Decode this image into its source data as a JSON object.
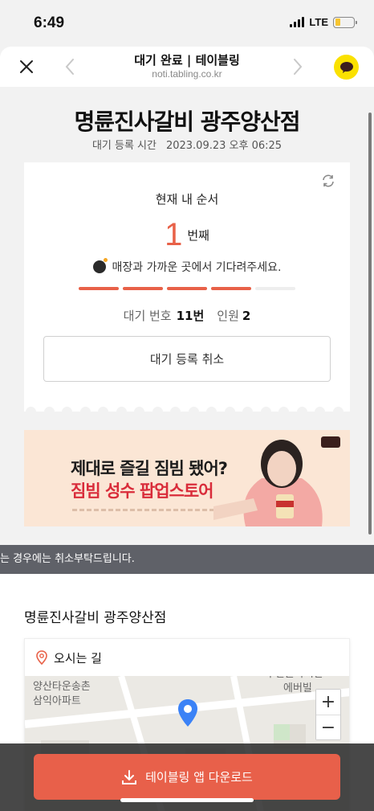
{
  "status_bar": {
    "time": "6:49",
    "network": "LTE",
    "battery_level": 0.3,
    "battery_color": "#f7c531"
  },
  "nav": {
    "title": "대기 완료 | 테이블링",
    "url": "noti.tabling.co.kr"
  },
  "store": {
    "name": "명륜진사갈비 광주양산점",
    "reg_label": "대기 등록 시간",
    "reg_time": "2023.09.23 오후 06:25"
  },
  "queue": {
    "order_label": "현재 내 순서",
    "order_number": "1",
    "order_unit": "번째",
    "message": "매장과 가까운 곳에서 기다려주세요.",
    "progress_steps_total": 5,
    "progress_steps_done": 4,
    "waiting_number_label": "대기 번호",
    "waiting_number": "11번",
    "people_label": "인원",
    "people": "2",
    "cancel_label": "대기 등록 취소"
  },
  "banner": {
    "line1": "제대로 즐길 짐빔 됐어?",
    "line2": "짐빔 성수 팝업스토어"
  },
  "notice": {
    "text": "는 경우에는 취소부탁드립니다."
  },
  "location": {
    "store_name": "명륜진사갈비 광주양산점",
    "directions_label": "오시는 길",
    "map_labels": [
      "양산타운송촌",
      "삼익아파트",
      "우산글라시안",
      "에버빌"
    ]
  },
  "bottom": {
    "download_label": "테이블링 앱 다운로드"
  },
  "colors": {
    "accent": "#e86148",
    "notice_bg": "#5f6168",
    "kakao": "#fae100"
  }
}
